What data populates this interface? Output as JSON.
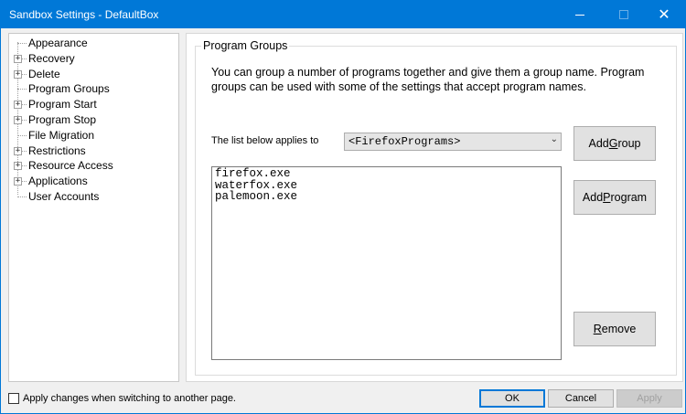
{
  "window": {
    "title": "Sandbox Settings - DefaultBox",
    "minimize": "minimize",
    "maximize": "maximize",
    "close": "✕"
  },
  "tree": {
    "items": [
      {
        "label": "Appearance",
        "expandable": false
      },
      {
        "label": "Recovery",
        "expandable": true
      },
      {
        "label": "Delete",
        "expandable": true
      },
      {
        "label": "Program Groups",
        "expandable": false,
        "selected": true
      },
      {
        "label": "Program Start",
        "expandable": true
      },
      {
        "label": "Program Stop",
        "expandable": true
      },
      {
        "label": "File Migration",
        "expandable": false
      },
      {
        "label": "Restrictions",
        "expandable": true
      },
      {
        "label": "Resource Access",
        "expandable": true
      },
      {
        "label": "Applications",
        "expandable": true
      },
      {
        "label": "User Accounts",
        "expandable": false
      }
    ]
  },
  "group": {
    "title": "Program Groups",
    "description": "You can group a number of programs together and give them a group name.  Program groups can be used with some of the settings that accept program names.",
    "applies_label": "The list below applies to",
    "combo_value": "<FirefoxPrograms>",
    "programs": [
      "firefox.exe",
      "waterfox.exe",
      "palemoon.exe"
    ],
    "add_group": {
      "pre": "Add ",
      "accel": "G",
      "post": "roup"
    },
    "add_program": {
      "pre": "Add ",
      "accel": "P",
      "post": "rogram"
    },
    "remove": {
      "pre": "",
      "accel": "R",
      "post": "emove"
    }
  },
  "footer": {
    "apply_on_switch": "Apply changes when switching to another page.",
    "ok": "OK",
    "cancel": "Cancel",
    "apply": "Apply"
  },
  "colors": {
    "titlebar": "#0078d7",
    "accent": "#0078d7"
  }
}
